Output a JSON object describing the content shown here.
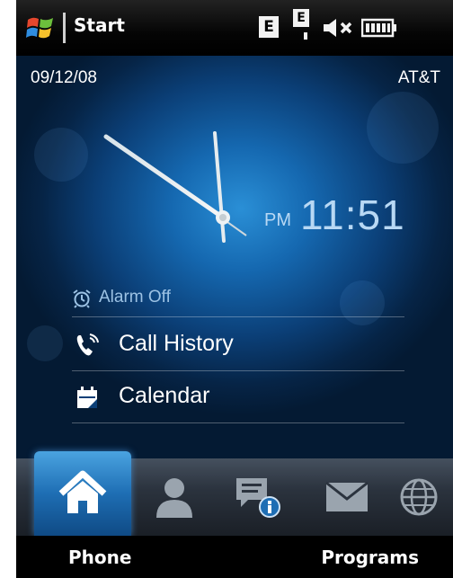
{
  "status_bar": {
    "start_label": "Start",
    "network_badge": "E",
    "network_badge_2": "E"
  },
  "home": {
    "date": "09/12/08",
    "carrier": "AT&T",
    "clock": {
      "ampm": "PM",
      "time": "11:51"
    },
    "alarm": {
      "label": "Alarm Off"
    },
    "links": {
      "call_history": "Call History",
      "calendar": "Calendar"
    }
  },
  "tabs": {
    "items": [
      "home-icon",
      "people-icon",
      "messaging-icon",
      "mail-icon",
      "web-icon"
    ],
    "selected": "home-icon"
  },
  "softkeys": {
    "left": "Phone",
    "right": "Programs"
  },
  "colors": {
    "accent": "#1e6eb4",
    "time_text": "#b8d8f4"
  }
}
